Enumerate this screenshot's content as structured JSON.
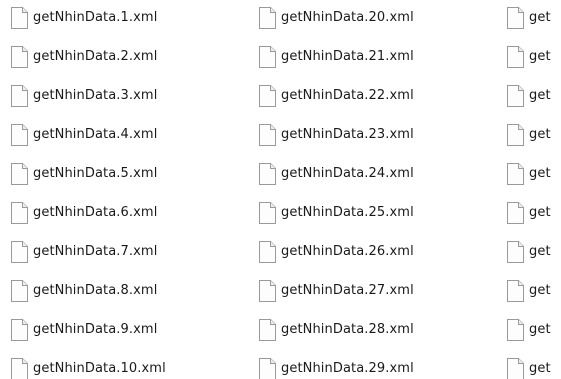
{
  "file_list": {
    "icon": "document-icon",
    "columns": [
      {
        "items": [
          "getNhinData.1.xml",
          "getNhinData.2.xml",
          "getNhinData.3.xml",
          "getNhinData.4.xml",
          "getNhinData.5.xml",
          "getNhinData.6.xml",
          "getNhinData.7.xml",
          "getNhinData.8.xml",
          "getNhinData.9.xml",
          "getNhinData.10.xml"
        ]
      },
      {
        "items": [
          "getNhinData.20.xml",
          "getNhinData.21.xml",
          "getNhinData.22.xml",
          "getNhinData.23.xml",
          "getNhinData.24.xml",
          "getNhinData.25.xml",
          "getNhinData.26.xml",
          "getNhinData.27.xml",
          "getNhinData.28.xml",
          "getNhinData.29.xml"
        ]
      },
      {
        "items": [
          "get",
          "get",
          "get",
          "get",
          "get",
          "get",
          "get",
          "get",
          "get",
          "get"
        ]
      }
    ]
  }
}
